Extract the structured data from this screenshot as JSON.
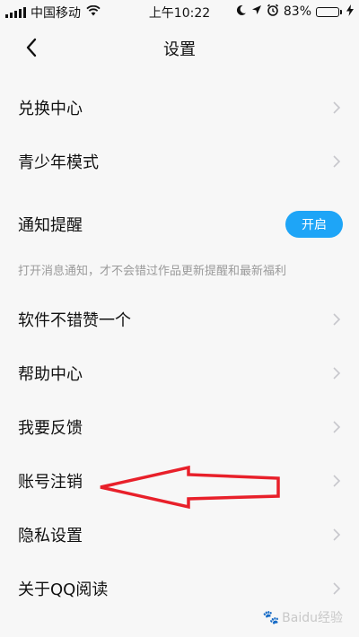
{
  "status_bar": {
    "carrier": "中国移动",
    "time": "上午10:22",
    "battery_percent_label": "83%",
    "battery_level": 0.83,
    "colors": {
      "battery_fill": "#4cd964"
    }
  },
  "nav": {
    "title": "设置",
    "back_icon": "chevron-left-icon"
  },
  "menu": {
    "redeem_center": "兑换中心",
    "youth_mode": "青少年模式",
    "notification": {
      "label": "通知提醒",
      "toggle_label": "开启",
      "description": "打开消息通知，才不会错过作品更新提醒和最新福利"
    },
    "rate_app": "软件不错赞一个",
    "help_center": "帮助中心",
    "feedback": "我要反馈",
    "account_deletion": "账号注销",
    "privacy_settings": "隐私设置",
    "about": "关于QQ阅读"
  },
  "watermark": {
    "text": "Baidu经验"
  },
  "colors": {
    "accent": "#1ea5f7",
    "annotation_arrow": "#e8202a",
    "background": "#f7f7f7"
  }
}
